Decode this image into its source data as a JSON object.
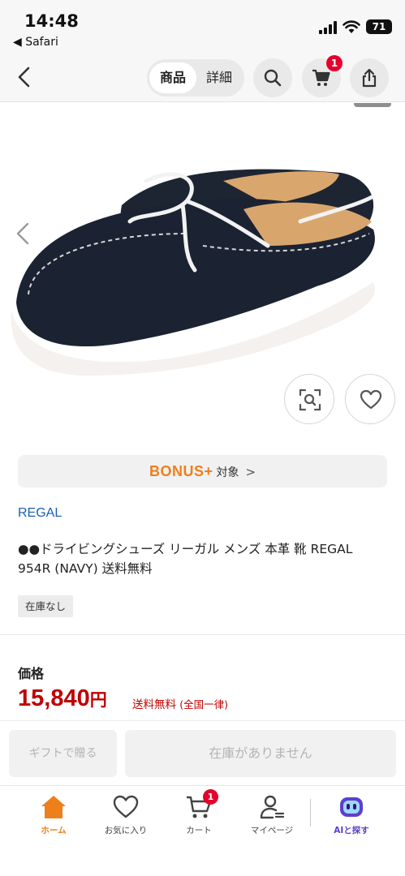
{
  "status_bar": {
    "time": "14:48",
    "back_app": "◀ Safari",
    "battery": "71"
  },
  "nav": {
    "tab_product": "商品",
    "tab_detail": "詳細",
    "cart_count": "1"
  },
  "bonus": {
    "logo": "BONUS+",
    "text": "対象",
    "chevron": ">"
  },
  "product": {
    "brand": "REGAL",
    "title": "●●ドライビングシューズ リーガル メンズ 本革 靴 REGAL 954R (NAVY) 送料無料",
    "stock_tag": "在庫なし"
  },
  "price": {
    "label": "価格",
    "amount": "15,840",
    "currency": "円",
    "shipping": "送料無料",
    "shipping_note": "(全国一律)"
  },
  "actions": {
    "gift": "ギフトで贈る",
    "out_of_stock": "在庫がありません"
  },
  "tabbar": {
    "home": "ホーム",
    "favorites": "お気に入り",
    "cart": "カート",
    "cart_count": "1",
    "mypage": "マイページ",
    "ai": "AIと探す"
  },
  "colors": {
    "accent": "#ee7f1a",
    "price": "#bf0000",
    "badge": "#e4002b",
    "brand_link": "#1a5fb4",
    "ai": "#5b3fd0"
  }
}
